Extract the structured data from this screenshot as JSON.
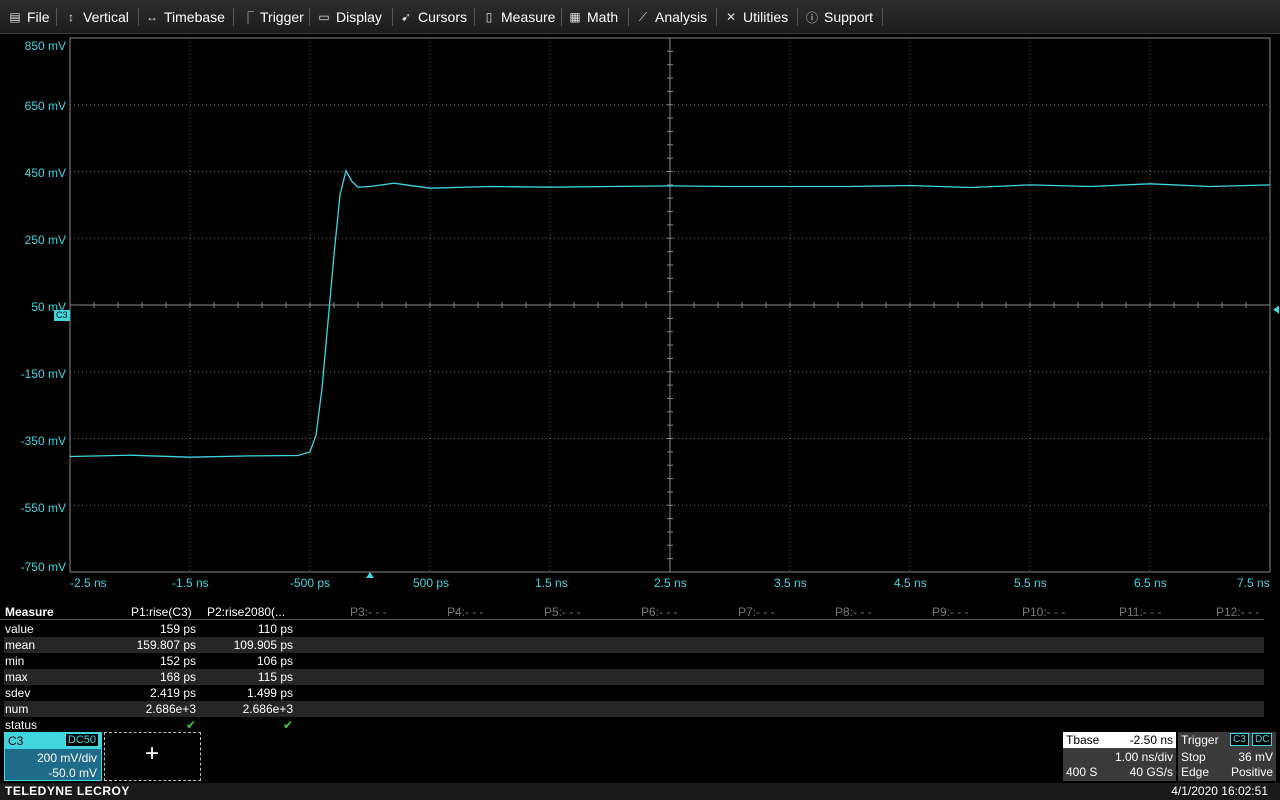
{
  "menu": [
    {
      "label": "File",
      "icon": "file-icon"
    },
    {
      "label": "Vertical",
      "icon": "vertical-icon"
    },
    {
      "label": "Timebase",
      "icon": "timebase-icon"
    },
    {
      "label": "Trigger",
      "icon": "trigger-icon"
    },
    {
      "label": "Display",
      "icon": "display-icon"
    },
    {
      "label": "Cursors",
      "icon": "cursors-icon"
    },
    {
      "label": "Measure",
      "icon": "measure-icon"
    },
    {
      "label": "Math",
      "icon": "math-icon"
    },
    {
      "label": "Analysis",
      "icon": "analysis-icon"
    },
    {
      "label": "Utilities",
      "icon": "utilities-icon"
    },
    {
      "label": "Support",
      "icon": "support-icon"
    }
  ],
  "grid": {
    "y_labels": [
      "850 mV",
      "650 mV",
      "450 mV",
      "250 mV",
      "50 mV",
      "-150 mV",
      "-350 mV",
      "-550 mV",
      "-750 mV"
    ],
    "x_labels": [
      "-2.5 ns",
      "-1.5 ns",
      "-500 ps",
      "500 ps",
      "1.5 ns",
      "2.5 ns",
      "3.5 ns",
      "4.5 ns",
      "5.5 ns",
      "6.5 ns",
      "7.5 ns"
    ],
    "channel_marker": "C3",
    "trace_color": "#3fd6e0"
  },
  "chart_data": {
    "type": "line",
    "series": [
      {
        "x": [
          -2.5,
          -2.0,
          -1.5,
          -1.0,
          -0.6,
          -0.5,
          -0.45,
          -0.4,
          -0.35,
          -0.3,
          -0.25,
          -0.2,
          -0.15,
          -0.1,
          0.0,
          0.2,
          0.5,
          1.0,
          1.5,
          2.0,
          2.5,
          3.0,
          3.5,
          4.0,
          4.5,
          5.0,
          5.5,
          6.0,
          6.5,
          7.0,
          7.5
        ],
        "y": [
          -404,
          -400,
          -406,
          -402,
          -401,
          -390,
          -340,
          -200,
          0,
          200,
          380,
          452,
          420,
          403,
          405,
          415,
          400,
          405,
          403,
          405,
          407,
          405,
          405,
          405,
          408,
          402,
          410,
          405,
          413,
          405,
          410
        ]
      }
    ],
    "xlim": [
      -2.5,
      7.5
    ],
    "ylim": [
      -750,
      850
    ]
  },
  "measure": {
    "title": "Measure",
    "params": [
      "P1:rise(C3)",
      "P2:rise2080(...",
      "P3:- - -",
      "P4:- - -",
      "P5:- - -",
      "P6:- - -",
      "P7:- - -",
      "P8:- - -",
      "P9:- - -",
      "P10:- - -",
      "P11:- - -",
      "P12:- - -"
    ],
    "rows": [
      {
        "label": "value",
        "p1": "159 ps",
        "p2": "110 ps"
      },
      {
        "label": "mean",
        "p1": "159.807 ps",
        "p2": "109.905 ps"
      },
      {
        "label": "min",
        "p1": "152 ps",
        "p2": "106 ps"
      },
      {
        "label": "max",
        "p1": "168 ps",
        "p2": "115 ps"
      },
      {
        "label": "sdev",
        "p1": "2.419 ps",
        "p2": "1.499 ps"
      },
      {
        "label": "num",
        "p1": "2.686e+3",
        "p2": "2.686e+3"
      },
      {
        "label": "status",
        "p1": "✔",
        "p2": "✔"
      }
    ]
  },
  "channel": {
    "name": "C3",
    "coupling": "DC50",
    "vdiv": "200 mV/div",
    "offset": "-50.0 mV"
  },
  "add": {
    "symbol": "+"
  },
  "tbase": {
    "label": "Tbase",
    "delay": "-2.50 ns",
    "tdiv": "1.00 ns/div",
    "samples": "400 S",
    "rate": "40 GS/s"
  },
  "trigger": {
    "label": "Trigger",
    "source": "C3",
    "coupling": "DC",
    "mode": "Stop",
    "level": "36 mV",
    "type": "Edge",
    "slope": "Positive"
  },
  "footer": {
    "brand": "TELEDYNE LECROY",
    "datetime": "4/1/2020 16:02:51"
  }
}
